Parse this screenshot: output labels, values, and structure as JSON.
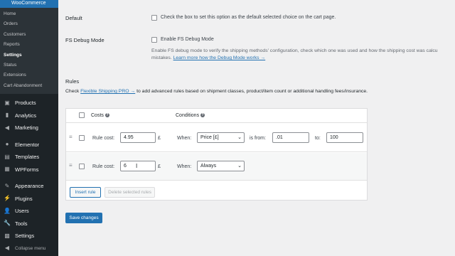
{
  "sidebar": {
    "top_title": "WooCommerce",
    "sub_items": [
      {
        "label": "Home"
      },
      {
        "label": "Orders"
      },
      {
        "label": "Customers"
      },
      {
        "label": "Reports"
      },
      {
        "label": "Settings"
      },
      {
        "label": "Status"
      },
      {
        "label": "Extensions"
      },
      {
        "label": "Cart Abandonment"
      }
    ],
    "items": [
      {
        "label": "Products",
        "icon": "products-icon"
      },
      {
        "label": "Analytics",
        "icon": "analytics-icon"
      },
      {
        "label": "Marketing",
        "icon": "marketing-icon"
      },
      {
        "label": "Elementor",
        "icon": "elementor-icon"
      },
      {
        "label": "Templates",
        "icon": "templates-icon"
      },
      {
        "label": "WPForms",
        "icon": "wpforms-icon"
      },
      {
        "label": "Appearance",
        "icon": "appearance-icon"
      },
      {
        "label": "Plugins",
        "icon": "plugins-icon"
      },
      {
        "label": "Users",
        "icon": "users-icon"
      },
      {
        "label": "Tools",
        "icon": "tools-icon"
      },
      {
        "label": "Settings",
        "icon": "settings-icon"
      }
    ],
    "collapse_label": "Collapse menu"
  },
  "settings": {
    "default": {
      "label": "Default",
      "text": "Check the box to set this option as the default selected choice on the cart page."
    },
    "debug": {
      "label": "FS Debug Mode",
      "text": "Enable FS Debug Mode",
      "desc_line1": "Enable FS debug mode to verify the shipping methods' configuration, check which one was used and how the shipping cost was calcu",
      "desc_line2_prefix": "mistakes.",
      "desc_link": "Learn more how the Debug Mode works →"
    }
  },
  "rules": {
    "heading": "Rules",
    "check_prefix": "Check",
    "pro_link": "Flexible Shipping PRO →",
    "check_suffix": "to add advanced rules based on shipment classes, product/item count or additional handling fees/insurance.",
    "columns": {
      "costs": "Costs",
      "conditions": "Conditions",
      "help": "?"
    },
    "rows": [
      {
        "cost_label": "Rule cost:",
        "cost_value": "4.95",
        "currency": "£",
        "when_label": "When:",
        "condition": "Price [£]",
        "from_label": "is from:",
        "from_value": ".01",
        "to_label": "to:",
        "to_value": "100"
      },
      {
        "cost_label": "Rule cost:",
        "cost_value": "6",
        "currency": "£",
        "when_label": "When:",
        "condition": "Always"
      }
    ],
    "insert_rule": "Insert rule",
    "delete_rules": "Delete selected rules"
  },
  "save_changes": "Save changes"
}
